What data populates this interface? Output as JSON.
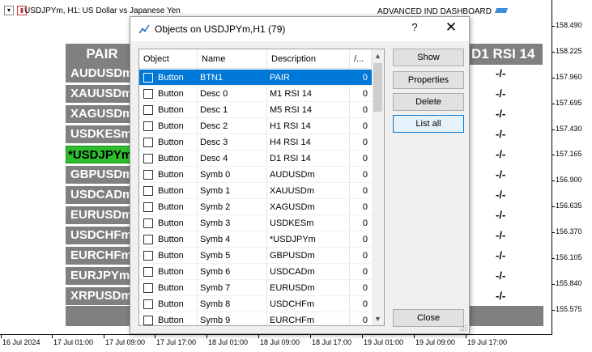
{
  "chart": {
    "title": "USDJPYm, H1:  US Dollar vs Japanese Yen",
    "dashboard_title": "ADVANCED IND DASHBOARD",
    "y_ticks": [
      "158.490",
      "158.225",
      "157.960",
      "157.695",
      "157.430",
      "157.165",
      "156.900",
      "156.635",
      "156.370",
      "156.105",
      "155.840",
      "155.575"
    ],
    "x_ticks": [
      "16 Jul 2024",
      "17 Jul 01:00",
      "17 Jul 09:00",
      "17 Jul 17:00",
      "18 Jul 01:00",
      "18 Jul 09:00",
      "18 Jul 17:00",
      "19 Jul 01:00",
      "19 Jul 09:00",
      "19 Jul 17:00"
    ]
  },
  "dashboard": {
    "pair_header": "PAIR",
    "pairs": [
      "AUDUSDm",
      "XAUUSDm",
      "XAGUSDm",
      "USDKESm",
      "*USDJPYm",
      "GBPUSDm",
      "USDCADm",
      "EURUSDm",
      "USDCHFm",
      "EURCHFm",
      "EURJPYm",
      "XRPUSDm"
    ],
    "active_pair_index": 4,
    "rsi_header": "D1 RSI 14",
    "rsi_values": [
      "-/-",
      "-/-",
      "-/-",
      "-/-",
      "-/-",
      "-/-",
      "-/-",
      "-/-",
      "-/-",
      "-/-",
      "-/-",
      "-/-"
    ]
  },
  "dialog": {
    "title": "Objects on USDJPYm,H1 (79)",
    "help": "?",
    "close_glyph": "✕",
    "columns": [
      "Object",
      "Name",
      "Description",
      "/..."
    ],
    "rows": [
      {
        "object": "Button",
        "name": "BTN1",
        "desc": "PAIR",
        "n": "0"
      },
      {
        "object": "Button",
        "name": "Desc 0",
        "desc": "M1 RSI 14",
        "n": "0"
      },
      {
        "object": "Button",
        "name": "Desc 1",
        "desc": "M5 RSI 14",
        "n": "0"
      },
      {
        "object": "Button",
        "name": "Desc 2",
        "desc": "H1 RSI 14",
        "n": "0"
      },
      {
        "object": "Button",
        "name": "Desc 3",
        "desc": "H4 RSI 14",
        "n": "0"
      },
      {
        "object": "Button",
        "name": "Desc 4",
        "desc": "D1 RSI 14",
        "n": "0"
      },
      {
        "object": "Button",
        "name": "Symb 0",
        "desc": "AUDUSDm",
        "n": "0"
      },
      {
        "object": "Button",
        "name": "Symb 1",
        "desc": "XAUUSDm",
        "n": "0"
      },
      {
        "object": "Button",
        "name": "Symb 2",
        "desc": "XAGUSDm",
        "n": "0"
      },
      {
        "object": "Button",
        "name": "Symb 3",
        "desc": "USDKESm",
        "n": "0"
      },
      {
        "object": "Button",
        "name": "Symb 4",
        "desc": "*USDJPYm",
        "n": "0"
      },
      {
        "object": "Button",
        "name": "Symb 5",
        "desc": "GBPUSDm",
        "n": "0"
      },
      {
        "object": "Button",
        "name": "Symb 6",
        "desc": "USDCADm",
        "n": "0"
      },
      {
        "object": "Button",
        "name": "Symb 7",
        "desc": "EURUSDm",
        "n": "0"
      },
      {
        "object": "Button",
        "name": "Symb 8",
        "desc": "USDCHFm",
        "n": "0"
      },
      {
        "object": "Button",
        "name": "Symb 9",
        "desc": "EURCHFm",
        "n": "0"
      }
    ],
    "selected_row": 0,
    "buttons": {
      "show": "Show",
      "properties": "Properties",
      "delete": "Delete",
      "list_all": "List all",
      "close": "Close"
    }
  },
  "colors": {
    "selection": "#0078d7",
    "active_pair": "#2ebd2e",
    "panel_gray": "#808080"
  }
}
